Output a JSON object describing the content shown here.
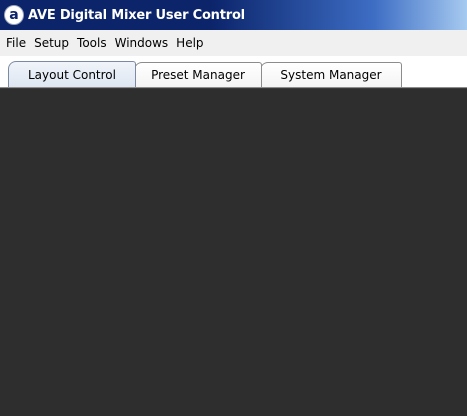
{
  "window": {
    "title": "AVE Digital Mixer User Control",
    "icon": "a"
  },
  "menu": {
    "items": [
      "File",
      "Setup",
      "Tools",
      "Windows",
      "Help"
    ]
  },
  "tabs": [
    {
      "label": "Layout Control",
      "active": true
    },
    {
      "label": "Preset Manager",
      "active": false
    },
    {
      "label": "System Manager",
      "active": false
    }
  ],
  "colors": {
    "titlebar": "#0b246a",
    "menubar": "#f0f0f0",
    "content": "#2e2e2e"
  }
}
